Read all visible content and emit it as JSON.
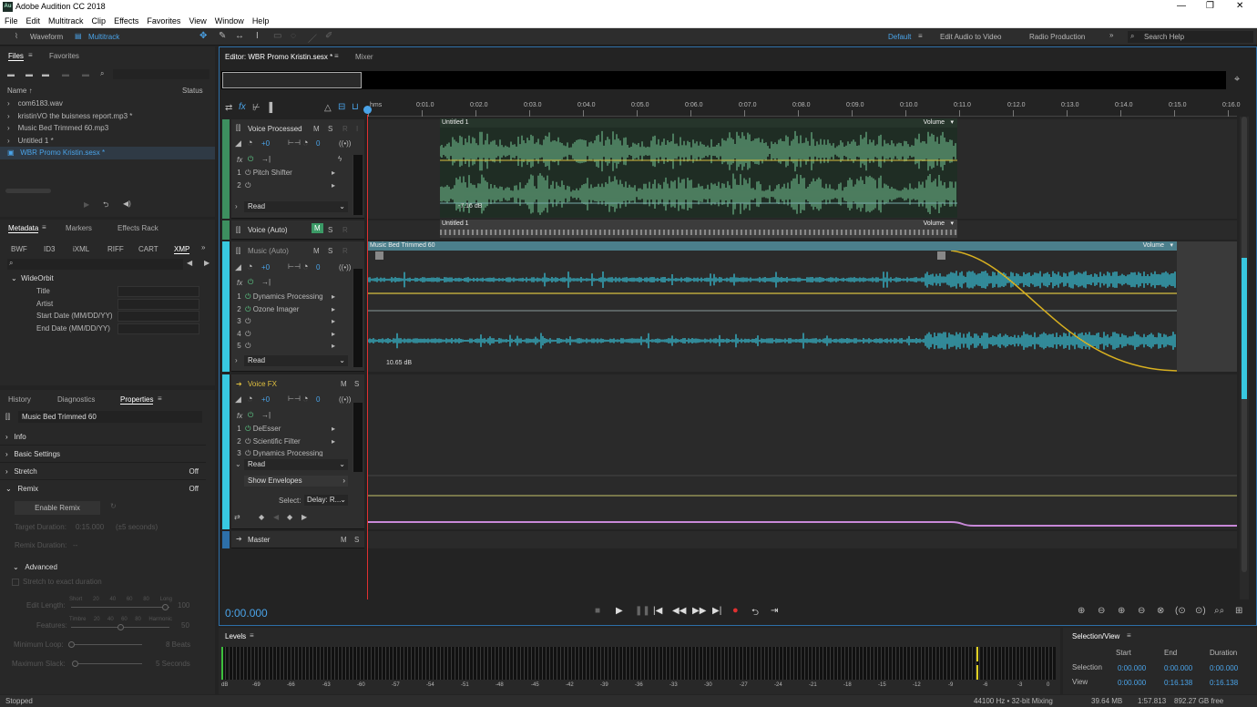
{
  "app": {
    "title": "Adobe Audition CC 2018",
    "icon": "Au",
    "controls": [
      "—",
      "❐",
      "✕"
    ]
  },
  "menu": [
    "File",
    "Edit",
    "Multitrack",
    "Clip",
    "Effects",
    "Favorites",
    "View",
    "Window",
    "Help"
  ],
  "toolbar": {
    "waveform": "Waveform",
    "multitrack": "Multitrack",
    "workspaces": [
      "Default",
      "Edit Audio to Video",
      "Radio Production"
    ],
    "search_placeholder": "Search Help"
  },
  "files_panel": {
    "tabs": [
      "Files",
      "Favorites"
    ],
    "col_name": "Name ↑",
    "col_status": "Status",
    "items": [
      {
        "name": "com6183.wav"
      },
      {
        "name": "kristinVO the buisness report.mp3 *"
      },
      {
        "name": "Music Bed Trimmed 60.mp3"
      },
      {
        "name": "Untitled 1 *"
      },
      {
        "name": "WBR Promo Kristin.sesx *"
      }
    ]
  },
  "metadata_panel": {
    "tabs": [
      "Metadata",
      "Markers",
      "Effects Rack"
    ],
    "subtabs": [
      "BWF",
      "ID3",
      "iXML",
      "RIFF",
      "CART",
      "XMP"
    ],
    "group": "WideOrbit",
    "fields": [
      "Title",
      "Artist",
      "Start Date (MM/DD/YY)",
      "End Date (MM/DD/YY)"
    ]
  },
  "properties_panel": {
    "tabs": [
      "History",
      "Diagnostics",
      "Properties"
    ],
    "clip_name": "Music Bed Trimmed 60",
    "sections": [
      {
        "label": "Info",
        "value": ""
      },
      {
        "label": "Basic Settings",
        "value": ""
      },
      {
        "label": "Stretch",
        "value": "Off"
      },
      {
        "label": "Remix",
        "value": "Off"
      }
    ],
    "enable_remix": "Enable Remix",
    "target_duration_label": "Target Duration:",
    "target_duration_value": "0:15.000",
    "target_duration_hint": "(±5 seconds)",
    "remix_duration_label": "Remix Duration:",
    "remix_duration_value": "--",
    "advanced": "Advanced",
    "stretch_exact": "Stretch to exact duration",
    "edit_length": "Edit Length:",
    "edit_length_scale": [
      "Short",
      "20",
      "40",
      "60",
      "80",
      "Long"
    ],
    "edit_length_value": "100",
    "features": "Features:",
    "features_scale": [
      "Timbre",
      "20",
      "40",
      "60",
      "80",
      "Harmonic"
    ],
    "features_value": "50",
    "min_loop": "Minimum Loop:",
    "min_loop_value": "8 Beats",
    "max_slack": "Maximum Slack:",
    "max_slack_value": "5 Seconds"
  },
  "editor": {
    "tab": "Editor: WBR Promo Kristin.sesx *",
    "mixer_tab": "Mixer",
    "ruler": [
      "hms",
      "0:01.0",
      "0:02.0",
      "0:03.0",
      "0:04.0",
      "0:05.0",
      "0:06.0",
      "0:07.0",
      "0:08.0",
      "0:09.0",
      "0:10.0",
      "0:11.0",
      "0:12.0",
      "0:13.0",
      "0:14.0",
      "0:15.0",
      "0:16.0"
    ],
    "time": "0:00.000"
  },
  "tracks": [
    {
      "name": "Voice Processed",
      "volume": "+0",
      "pan": "0",
      "effects": [
        "Pitch Shifter",
        "",
        ""
      ],
      "mode": "Read",
      "clip": "Untitled 1",
      "clip_db": "-7.16 dB",
      "env": "Volume"
    },
    {
      "name": "Voice (Auto)",
      "clip": "Untitled 1",
      "env": "Volume"
    },
    {
      "name": "Music (Auto)",
      "volume": "+0",
      "pan": "0",
      "effects": [
        "Dynamics Processing",
        "Ozone Imager",
        "",
        "",
        ""
      ],
      "mode": "Read",
      "clip": "Music Bed Trimmed 60",
      "clip_db": "10.65 dB",
      "env": "Volume"
    },
    {
      "name": "Voice FX",
      "volume": "+0",
      "pan": "0",
      "effects": [
        "DeEsser",
        "Scientific Filter",
        "Dynamics Processing"
      ],
      "mode": "Read",
      "show_env": "Show Envelopes",
      "select_label": "Select:",
      "select_value": "Delay: R..."
    },
    {
      "name": "Master"
    }
  ],
  "track_buttons": {
    "m": "M",
    "s": "S",
    "r": "R",
    "i": "I"
  },
  "levels": {
    "title": "Levels",
    "scale": [
      "dB",
      "-69",
      "-66",
      "-63",
      "-60",
      "-57",
      "-54",
      "-51",
      "-48",
      "-45",
      "-42",
      "-39",
      "-36",
      "-33",
      "-30",
      "-27",
      "-24",
      "-21",
      "-18",
      "-15",
      "-12",
      "-9",
      "-6",
      "-3",
      "0"
    ]
  },
  "selection_view": {
    "title": "Selection/View",
    "headers": [
      "Start",
      "End",
      "Duration"
    ],
    "rows": [
      {
        "label": "Selection",
        "start": "0:00.000",
        "end": "0:00.000",
        "duration": "0:00.000"
      },
      {
        "label": "View",
        "start": "0:00.000",
        "end": "0:16.138",
        "duration": "0:16.138"
      }
    ]
  },
  "status": {
    "left": "Stopped",
    "sample": "44100 Hz • 32-bit Mixing",
    "mem": "39.64 MB",
    "dur": "1:57.813",
    "free": "892.27 GB free"
  },
  "colors": {
    "accent": "#4aa3e8",
    "wave_green": "#5f9e78",
    "wave_cyan": "#38c8e0",
    "env_yellow": "#d8c040",
    "playhead": "#e03030"
  }
}
